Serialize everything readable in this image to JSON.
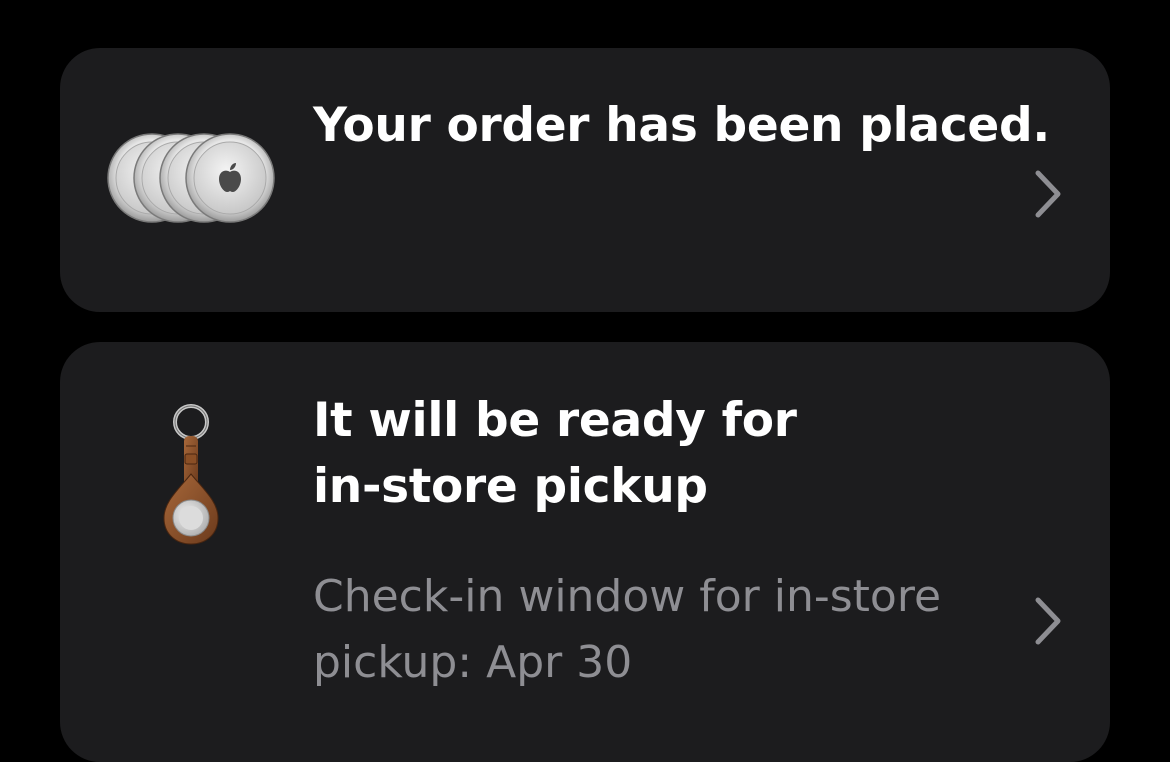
{
  "colors": {
    "background": "#000000",
    "card": "#1c1c1e",
    "title": "#ffffff",
    "secondary_text": "#8e8e93",
    "chevron": "#8e8e93"
  },
  "order_card": {
    "icon": "airtag-4-pack-icon",
    "title": "Your order has been placed.",
    "chevron_icon": "chevron-right-icon"
  },
  "pickup_card": {
    "icon": "airtag-leather-key-ring-icon",
    "title": "It will be ready for in-store pickup",
    "subtitle": "Check-in window for in-store pickup: Apr 30",
    "chevron_icon": "chevron-right-icon"
  }
}
